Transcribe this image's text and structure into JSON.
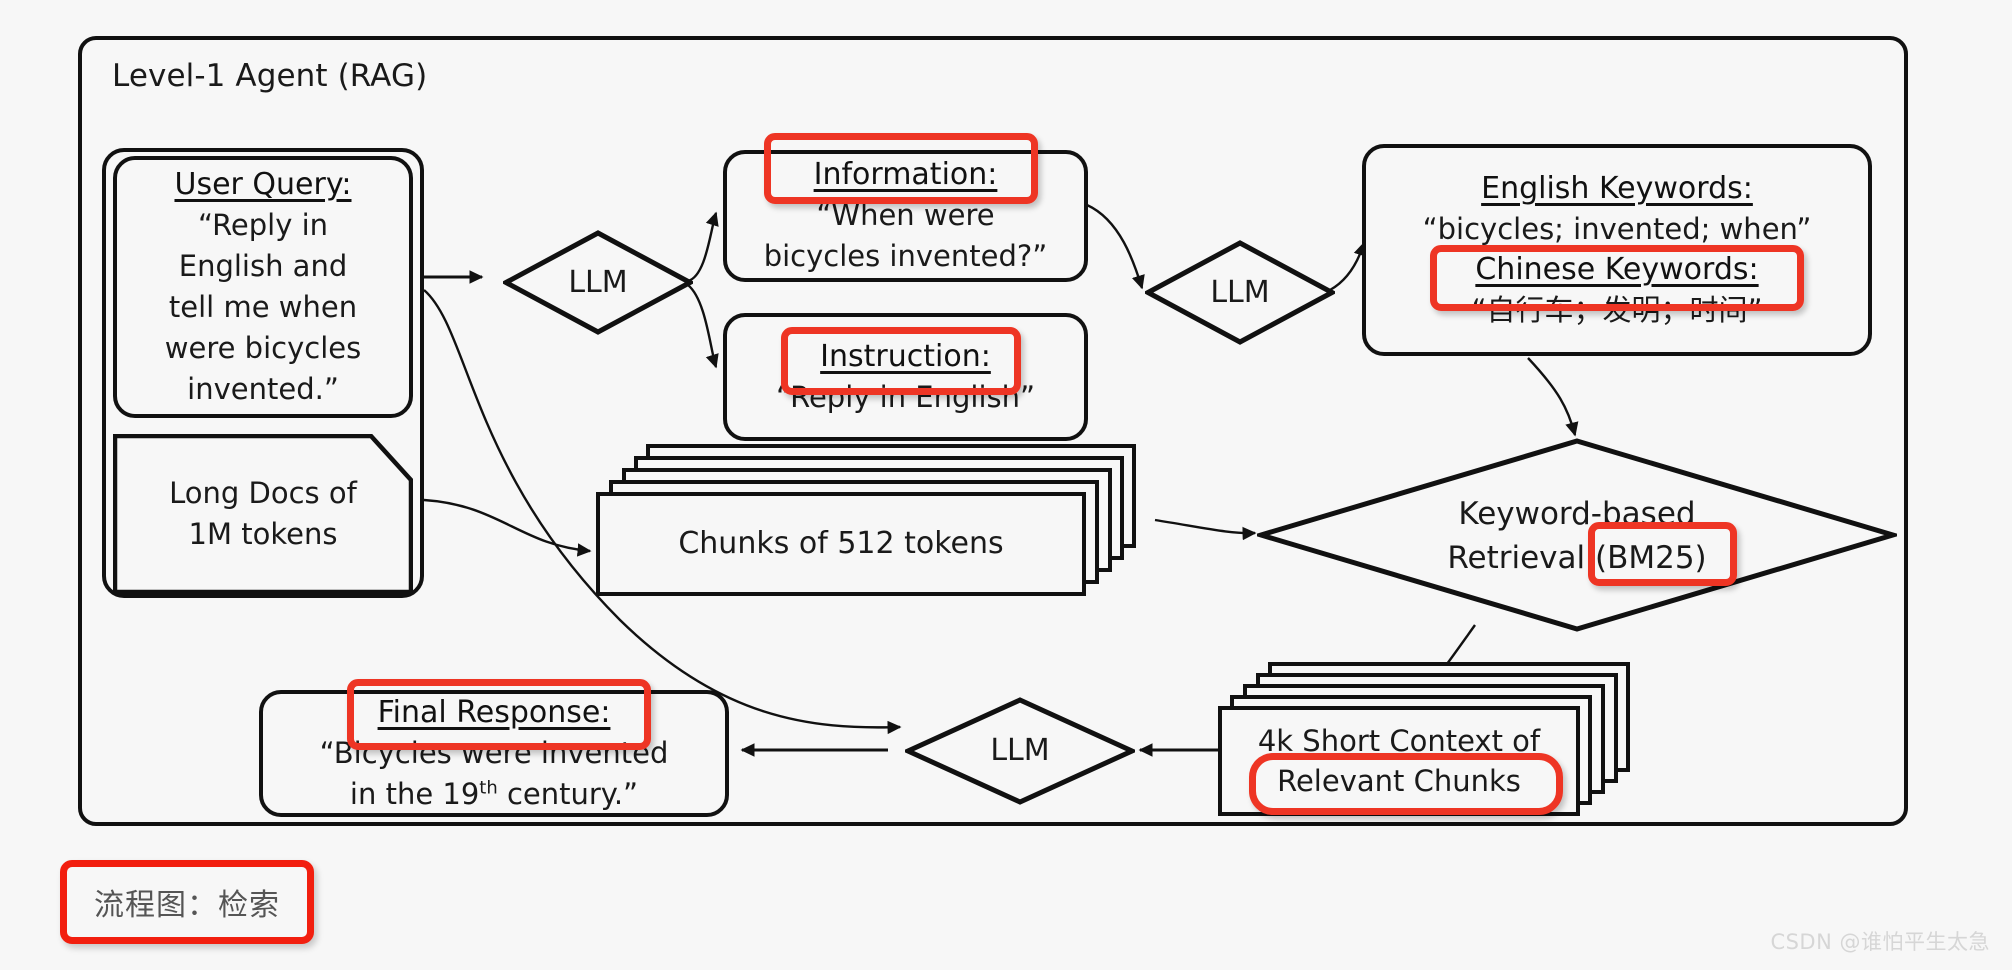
{
  "diagram": {
    "container_title": "Level-1 Agent (RAG)",
    "caption": "流程图：检索",
    "watermark": "CSDN @谁怕平生太急",
    "accent_color": "#ee3524",
    "line_color": "#111111",
    "background": "#f7f7f7"
  },
  "nodes": {
    "user_query": {
      "header": "User Query:",
      "lines": [
        "“Reply in",
        "English and",
        "tell me when",
        "were bicycles",
        "invented.”"
      ]
    },
    "long_docs": {
      "lines": [
        "Long Docs of",
        "1M tokens"
      ]
    },
    "llm_1": {
      "label": "LLM"
    },
    "llm_2": {
      "label": "LLM"
    },
    "llm_3": {
      "label": "LLM"
    },
    "information": {
      "header": "Information:",
      "lines": [
        "“When were",
        "bicycles invented?”"
      ]
    },
    "instruction": {
      "header": "Instruction:",
      "lines": [
        "“Reply in English”"
      ]
    },
    "keywords": {
      "header_en": "English Keywords:",
      "value_en": "“bicycles; invented; when”",
      "header_zh": "Chinese Keywords:",
      "value_zh": "“自行车；发明；时间”"
    },
    "retrieval": {
      "line1": "Keyword-based",
      "line2_prefix": "Retrieval ",
      "line2_highlight": "(BM25)"
    },
    "chunks": {
      "label": "Chunks of 512 tokens",
      "sheet_count": 5
    },
    "short_context": {
      "line1": "4k Short Context of",
      "line2": "Relevant Chunks",
      "sheet_count": 5
    },
    "final_response": {
      "header": "Final Response:",
      "line1": "“Bicycles were invented",
      "line2_a": "in the 19",
      "line2_sup": "th",
      "line2_b": " century.”"
    }
  },
  "highlights": [
    {
      "name": "information-header-highlight"
    },
    {
      "name": "instruction-header-highlight"
    },
    {
      "name": "chinese-keywords-highlight"
    },
    {
      "name": "bm25-highlight"
    },
    {
      "name": "relevant-chunks-highlight"
    },
    {
      "name": "final-response-highlight"
    }
  ]
}
